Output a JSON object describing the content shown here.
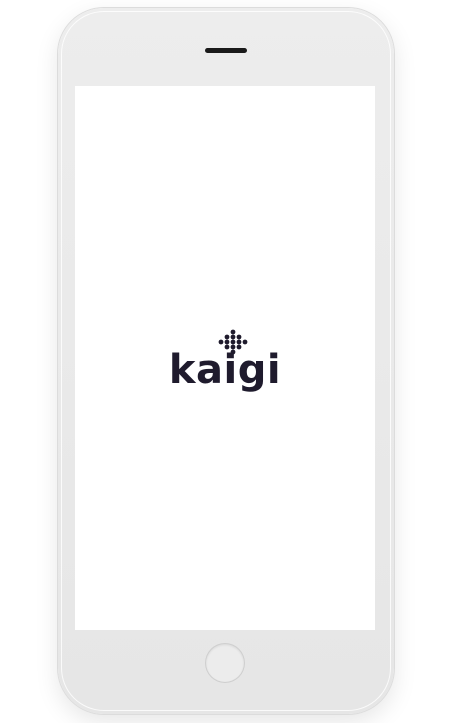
{
  "app": {
    "name": "kaigi"
  },
  "splash": {
    "logo_text": "kaigi",
    "logo_icon": "dot-diamond-icon",
    "brand_color": "#1f1b2d"
  },
  "device": {
    "frame_color": "#e9e9e9",
    "speaker_icon": "speaker-grille-icon",
    "home_button_icon": "home-button-icon"
  }
}
